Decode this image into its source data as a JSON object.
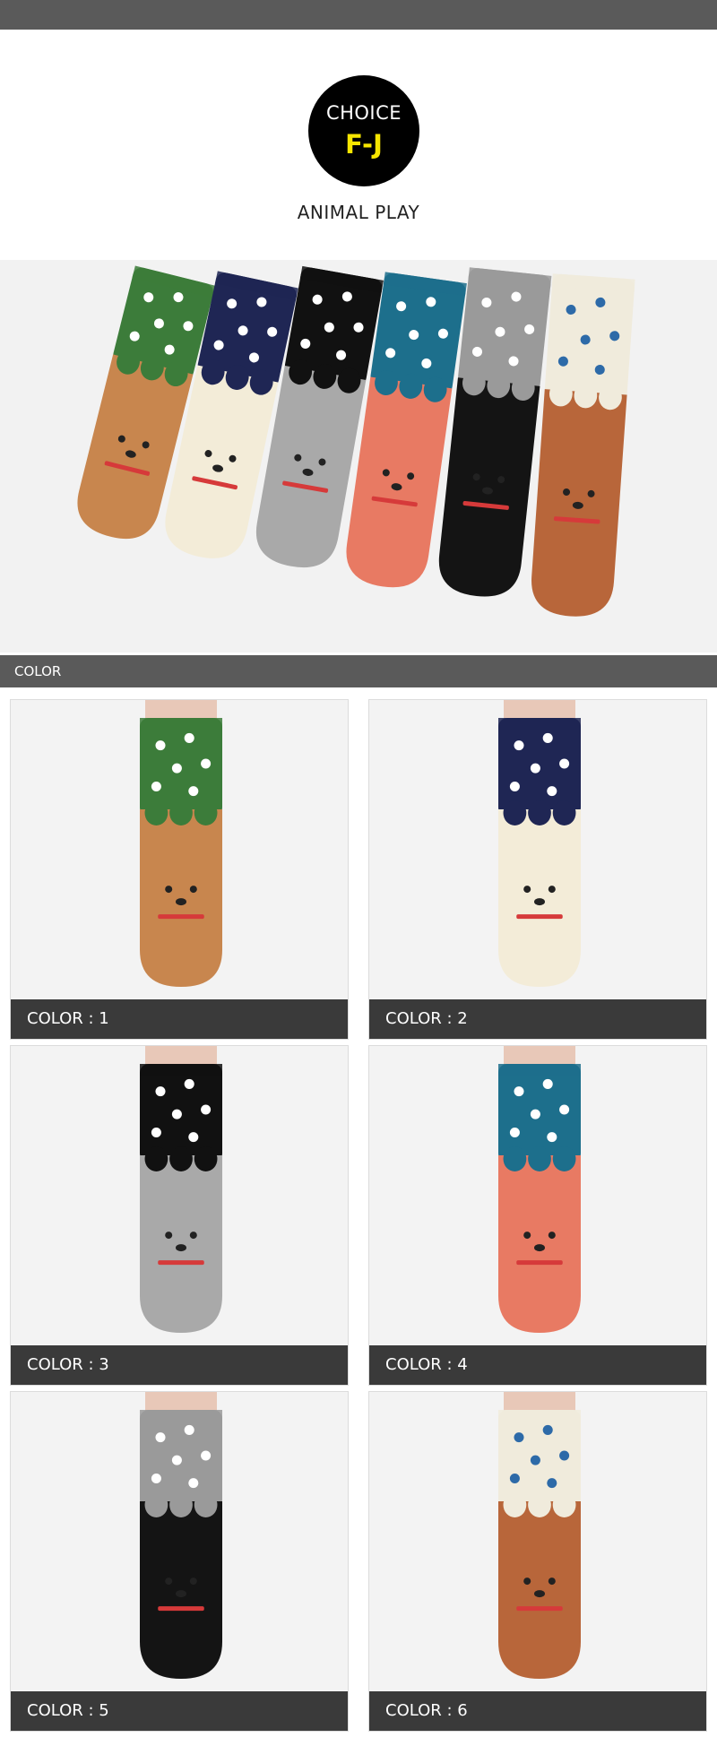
{
  "header": {
    "badge_line1": "CHOICE",
    "badge_line2": "F-J",
    "subtitle": "ANIMAL PLAY"
  },
  "section": {
    "title": "COLOR"
  },
  "colors": [
    {
      "label": "COLOR : 1",
      "top": "#3c7c3a",
      "body": "#c8864e",
      "dots": "#ffffff"
    },
    {
      "label": "COLOR : 2",
      "top": "#1f2654",
      "body": "#f3ecd8",
      "dots": "#ffffff"
    },
    {
      "label": "COLOR : 3",
      "top": "#111111",
      "body": "#a9a9a9",
      "dots": "#ffffff"
    },
    {
      "label": "COLOR : 4",
      "top": "#1d6f8c",
      "body": "#e87a63",
      "dots": "#ffffff"
    },
    {
      "label": "COLOR : 5",
      "top": "#9a9a9a",
      "body": "#141414",
      "dots": "#ffffff"
    },
    {
      "label": "COLOR : 6",
      "top": "#f0ebdc",
      "body": "#b8663a",
      "dots": "#2d6aa8"
    }
  ]
}
